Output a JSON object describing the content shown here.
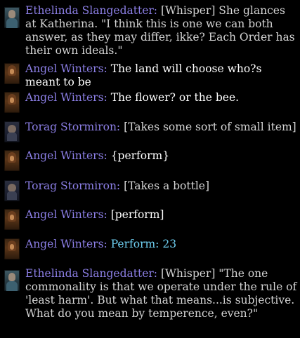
{
  "colors": {
    "background": "#000000",
    "speaker": "#8c7fe6",
    "emote_text": "#d4d4d4",
    "speech_text": "#ffffff",
    "roll_text": "#6fd0f2"
  },
  "messages": [
    {
      "speaker": "Ethelinda Slangedatter:",
      "avatar_icon": "ethelinda-portrait-icon",
      "text": "[Whisper] She glances at Katherina. \"I think this is one we can both answer, as they may differ, ikke? Each Order has their own ideals.\""
    },
    {
      "speaker": "Angel Winters:",
      "avatar_icon": "angel-portrait-icon",
      "text": "The land will choose who?s meant to be"
    },
    {
      "speaker": "Angel Winters:",
      "avatar_icon": "angel-portrait-icon",
      "text": "The flower? or the bee."
    },
    {
      "speaker": "Torag Stormiron:",
      "avatar_icon": "torag-portrait-icon",
      "text": "[Takes some sort of small item]"
    },
    {
      "speaker": "Angel Winters:",
      "avatar_icon": "angel-portrait-icon",
      "text": "{perform}"
    },
    {
      "speaker": "Torag Stormiron:",
      "avatar_icon": "torag-portrait-icon",
      "text": "[Takes a bottle]"
    },
    {
      "speaker": "Angel Winters:",
      "avatar_icon": "angel-portrait-icon",
      "text": "[perform]"
    },
    {
      "speaker": "Angel Winters:",
      "avatar_icon": "angel-portrait-icon",
      "text": "Perform: 23"
    },
    {
      "speaker": "Ethelinda Slangedatter:",
      "avatar_icon": "ethelinda-portrait-icon",
      "text": "[Whisper] \"The one commonality is that we operate under the rule of 'least harm'. But what that means...is subjective. What do you mean by temperence, even?\""
    }
  ]
}
